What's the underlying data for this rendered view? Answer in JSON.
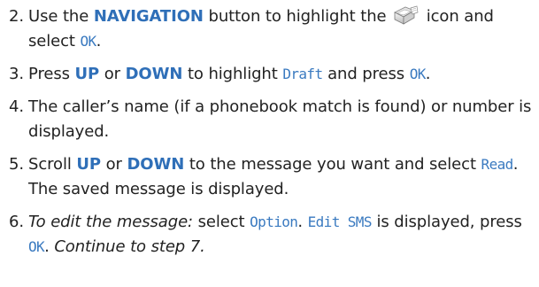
{
  "steps": [
    {
      "number": "2.",
      "parts": {
        "t1": "Use the ",
        "k1": "NAVIGATION",
        "t2": " button to highlight the ",
        "icon": "messages-icon",
        "t3": " icon and select ",
        "d1": "OK",
        "t4": "."
      }
    },
    {
      "number": "3.",
      "parts": {
        "t1": "Press ",
        "k1": "UP",
        "t2": " or ",
        "k2": "DOWN",
        "t3": " to highlight ",
        "d1": "Draft",
        "t4": " and press ",
        "d2": "OK",
        "t5": "."
      }
    },
    {
      "number": "4.",
      "parts": {
        "t1": "The caller’s name (if a phonebook match is found) or number is displayed."
      }
    },
    {
      "number": "5.",
      "parts": {
        "t1": "Scroll ",
        "k1": "UP",
        "t2": " or ",
        "k2": "DOWN",
        "t3": " to the message you want and select ",
        "d1": "Read",
        "t4": ". The saved message is displayed."
      }
    },
    {
      "number": "6.",
      "parts": {
        "e1": "To edit the message:",
        "t1": " select ",
        "d1": "Option",
        "t2": ". ",
        "d2": "Edit SMS",
        "t3": " is displayed, press ",
        "d3": "OK",
        "t4": ". ",
        "e2": "Continue to step 7."
      }
    }
  ],
  "colors": {
    "key_text": "#2f6fb8",
    "display_text": "#3a7ac0",
    "body_text": "#222222"
  }
}
